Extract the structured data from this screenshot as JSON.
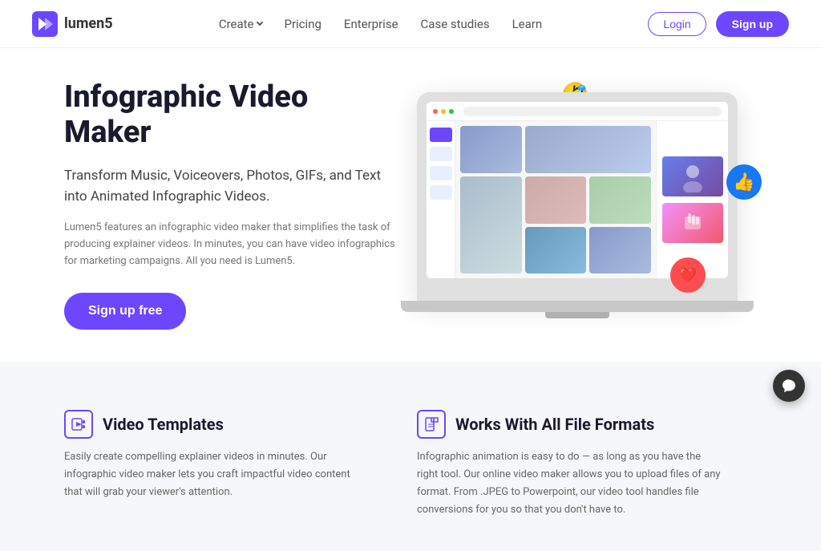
{
  "brand": {
    "name": "lumen5",
    "logo_label": "lumen5 logo"
  },
  "navbar": {
    "create_label": "Create",
    "pricing_label": "Pricing",
    "enterprise_label": "Enterprise",
    "case_studies_label": "Case studies",
    "learn_label": "Learn",
    "login_label": "Login",
    "signup_label": "Sign up"
  },
  "hero": {
    "title": "Infographic Video Maker",
    "subtitle": "Transform Music, Voiceovers, Photos, GIFs, and Text into Animated Infographic Videos.",
    "description": "Lumen5 features an infographic video maker that simplifies the task of producing explainer videos. In minutes, you can have video infographics for marketing campaigns. All you need is Lumen5.",
    "cta_label": "Sign up free"
  },
  "features": [
    {
      "id": "video-templates",
      "icon_label": "video-icon",
      "title": "Video Templates",
      "description": "Easily create compelling explainer videos in minutes. Our infographic video maker lets you craft impactful video content that will grab your viewer's attention."
    },
    {
      "id": "file-formats",
      "icon_label": "file-icon",
      "title": "Works With All File Formats",
      "description": "Infographic animation is easy to do — as long as you have the right tool. Our online video maker allows you to upload files of any format. From .JPEG to Powerpoint, our video tool handles file conversions for you so that you don't have to."
    }
  ],
  "floats": {
    "laugh_emoji": "🤣",
    "thumb_emoji": "👍",
    "heart_emoji": "❤️"
  },
  "chat_widget": {
    "label": "chat-support"
  }
}
